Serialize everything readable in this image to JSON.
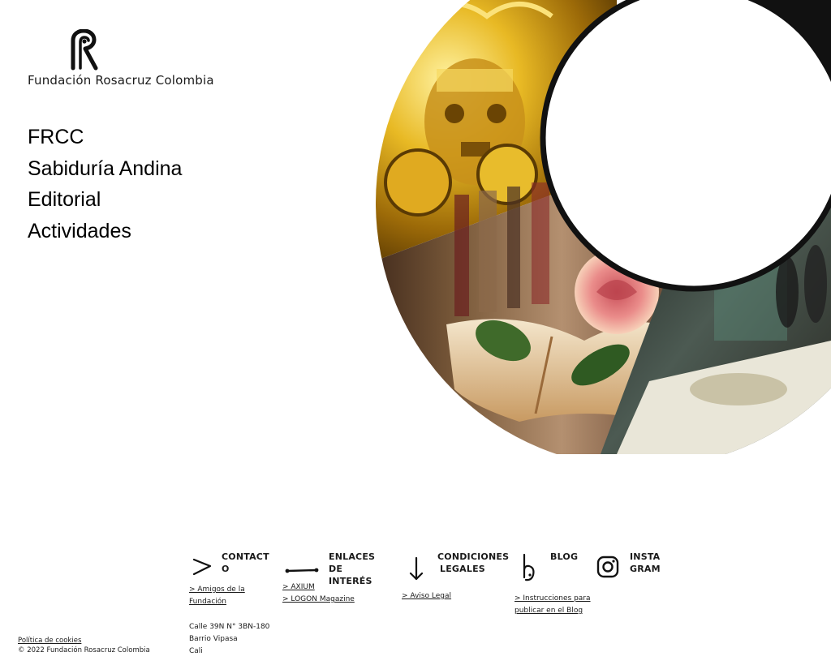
{
  "brand": {
    "name": "Fundación Rosacruz Colombia"
  },
  "nav": {
    "items": [
      {
        "label": "FRCC"
      },
      {
        "label": "Sabiduría Andina"
      },
      {
        "label": "Editorial"
      },
      {
        "label": "Actividades"
      }
    ]
  },
  "hero": {
    "icons": [
      "gold-andean-mask-image",
      "rose-on-book-image",
      "museum-exhibit-image"
    ]
  },
  "footer": {
    "contact": {
      "title_line1": "CONTACT",
      "title_line2": "O",
      "link_line1": "> Amigos de la",
      "link_line2": "Fundación",
      "address": [
        "Calle 39N N° 3BN-180",
        "Barrio Vipasa",
        "Cali"
      ]
    },
    "links": {
      "title_line1": "ENLACES DE",
      "title_line2": "INTERÉS",
      "items": [
        "> AXIUM",
        "> LOGON Magazine"
      ]
    },
    "legal_conditions": {
      "title_line1": "CONDICIONES",
      "title_line2": "LEGALES",
      "items": [
        "> Aviso Legal"
      ]
    },
    "blog": {
      "title": "BLOG",
      "link_line1": "> Instrucciones para",
      "link_line2": "publicar en el Blog"
    },
    "instagram": {
      "title_line1": "INSTA",
      "title_line2": "GRAM"
    },
    "cookies_link": "Política de cookies",
    "copyright": "© 2022 Fundación Rosacruz Colombia"
  }
}
